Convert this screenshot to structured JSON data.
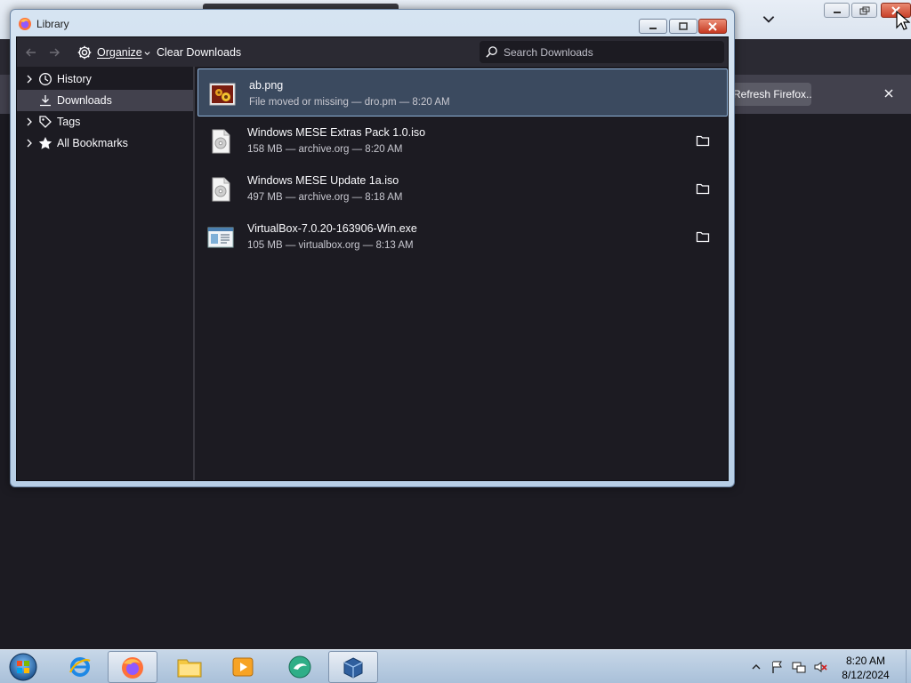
{
  "browser": {
    "notification": {
      "refresh_label": "Refresh Firefox..."
    }
  },
  "library": {
    "title": "Library",
    "toolbar": {
      "organize_label": "Organize",
      "clear_label": "Clear Downloads",
      "search_placeholder": "Search Downloads"
    },
    "sidebar": {
      "items": [
        {
          "label": "History",
          "icon": "clock-icon",
          "selected": false
        },
        {
          "label": "Downloads",
          "icon": "download-icon",
          "selected": true
        },
        {
          "label": "Tags",
          "icon": "tag-icon",
          "selected": false
        },
        {
          "label": "All Bookmarks",
          "icon": "star-icon",
          "selected": false
        }
      ]
    },
    "downloads": [
      {
        "name": "ab.png",
        "status": "File moved or missing — dro.pm — 8:20 AM",
        "icon": "image-file-icon",
        "selected": true
      },
      {
        "name": "Windows MESE Extras Pack 1.0.iso",
        "status": "158 MB — archive.org — 8:20 AM",
        "icon": "disc-file-icon",
        "selected": false
      },
      {
        "name": "Windows MESE Update 1a.iso",
        "status": "497 MB — archive.org — 8:18 AM",
        "icon": "disc-file-icon",
        "selected": false
      },
      {
        "name": "VirtualBox-7.0.20-163906-Win.exe",
        "status": "105 MB — virtualbox.org — 8:13 AM",
        "icon": "exe-file-icon",
        "selected": false
      }
    ]
  },
  "taskbar": {
    "clock": {
      "time": "8:20 AM",
      "date": "8/12/2024"
    }
  },
  "colors": {
    "library_bg": "#1c1b22",
    "toolbar_bg": "#2b2a33",
    "selection_bg": "#3b4a5f",
    "selection_border": "#8fb2d8",
    "close_red": "#c9412a"
  }
}
